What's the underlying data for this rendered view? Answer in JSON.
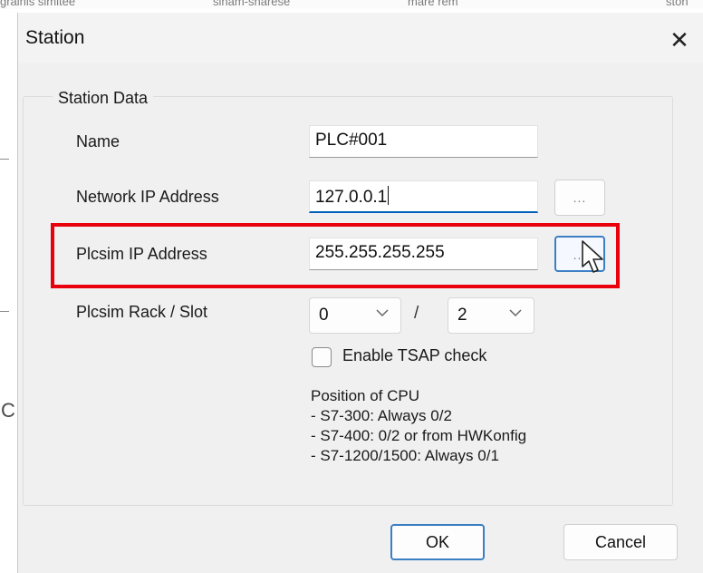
{
  "background": {
    "partial_labels": [
      "grainis simitee",
      "sinam-sharese",
      "mare rem",
      "ston"
    ]
  },
  "dialog": {
    "title": "Station",
    "close_glyph": "✕"
  },
  "group": {
    "label": "Station Data"
  },
  "fields": {
    "name": {
      "label": "Name",
      "value": "PLC#001"
    },
    "network_ip": {
      "label": "Network IP Address",
      "value": "127.0.0.1",
      "browse_label": "..."
    },
    "plcsim_ip": {
      "label": "Plcsim IP Address",
      "value": "255.255.255.255",
      "browse_label": "..."
    },
    "rack_slot": {
      "label": "Plcsim Rack / Slot",
      "rack_value": "0",
      "separator": "/",
      "slot_value": "2"
    }
  },
  "tsap": {
    "label": "Enable TSAP check",
    "checked": false
  },
  "info": {
    "heading": "Position of CPU",
    "lines": [
      "- S7-300: Always 0/2",
      "- S7-400: 0/2 or from HWKonfig",
      "- S7-1200/1500: Always 0/1"
    ]
  },
  "buttons": {
    "ok": "OK",
    "cancel": "Cancel"
  },
  "colors": {
    "highlight": "#e8000c",
    "focus_accent": "#005fb8",
    "dialog_bg": "#f0f0f0"
  },
  "icons": {
    "close": "close-icon",
    "dropdown": "chevron-down-icon",
    "cursor": "mouse-pointer-icon"
  }
}
